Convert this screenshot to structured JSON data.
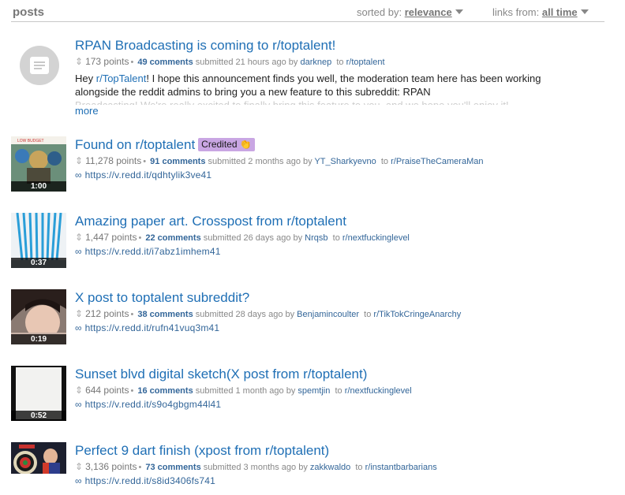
{
  "header": {
    "title": "posts",
    "sorted_label": "sorted by:",
    "sorted_value": "relevance",
    "links_label": "links from:",
    "links_value": "all time"
  },
  "posts": [
    {
      "title": "RPAN Broadcasting is coming to r/toptalent!",
      "points": "173 points",
      "comments": "49 comments",
      "submitted": "submitted 21 hours ago by",
      "author": "darknep",
      "to": "to",
      "subreddit": "r/toptalent",
      "selftext_prefix": "Hey",
      "selftext_link": "r/TopTalent",
      "selftext_rest": "! I hope this announcement finds you well, the moderation team here has been working alongside the reddit admins to bring you a new feature to this subreddit: RPAN",
      "selftext_fade": "Broadcasting! We're really excited to finally bring this feature to you, and we hope you'll enjoy it!",
      "more": "more"
    },
    {
      "title": "Found on r/toptalent",
      "flair": "Credited 👏",
      "duration": "1:00",
      "points": "11,278 points",
      "comments": "91 comments",
      "submitted": "submitted 2 months ago by",
      "author": "YT_Sharkyevno",
      "to": "to",
      "subreddit": "r/PraiseTheCameraMan",
      "url": "https://v.redd.it/qdhtylik3ve41"
    },
    {
      "title": "Amazing paper art. Crosspost from r/toptalent",
      "duration": "0:37",
      "points": "1,447 points",
      "comments": "22 comments",
      "submitted": "submitted 26 days ago by",
      "author": "Nrqsb",
      "to": "to",
      "subreddit": "r/nextfuckinglevel",
      "url": "https://v.redd.it/i7abz1imhem41"
    },
    {
      "title": "X post to toptalent subreddit?",
      "duration": "0:19",
      "points": "212 points",
      "comments": "38 comments",
      "submitted": "submitted 28 days ago by",
      "author": "Benjamincoulter",
      "to": "to",
      "subreddit": "r/TikTokCringeAnarchy",
      "url": "https://v.redd.it/rufn41vuq3m41"
    },
    {
      "title": "Sunset blvd digital sketch(X post from r/toptalent)",
      "duration": "0:52",
      "points": "644 points",
      "comments": "16 comments",
      "submitted": "submitted 1 month ago by",
      "author": "spemtjin",
      "to": "to",
      "subreddit": "r/nextfuckinglevel",
      "url": "https://v.redd.it/s9o4gbgm44l41"
    },
    {
      "title": "Perfect 9 dart finish (xpost from r/toptalent)",
      "points": "3,136 points",
      "comments": "73 comments",
      "submitted": "submitted 3 months ago by",
      "author": "zakkwaldo",
      "to": "to",
      "subreddit": "r/instantbarbarians",
      "url": "https://v.redd.it/s8id3406fs741"
    }
  ],
  "icons": {
    "vote": "updown-arrow-icon",
    "link": "chain-link-icon",
    "self": "text-post-icon"
  },
  "colors": {
    "title_link": "#1f6fb5",
    "meta_link": "#336699",
    "flair_bg": "#c9a6e3"
  }
}
